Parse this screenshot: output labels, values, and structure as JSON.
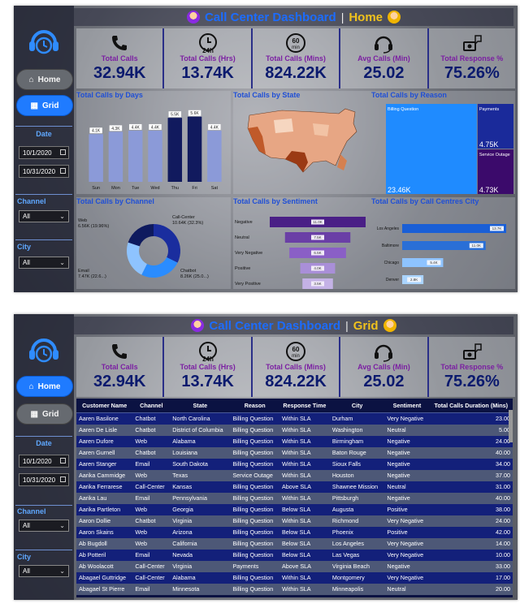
{
  "dashboard_title": "Call Center Dashboard",
  "separator": "|",
  "views": {
    "home": "Home",
    "grid": "Grid"
  },
  "sidebar": {
    "home_label": "Home",
    "grid_label": "Grid",
    "date_label": "Date",
    "start_date": "10/1/2020",
    "end_date": "10/31/2020",
    "channel_label": "Channel",
    "channel_value": "All",
    "city_label": "City",
    "city_value": "All"
  },
  "kpis": [
    {
      "label": "Total Calls",
      "value": "32.94K",
      "icon": "phone-icon"
    },
    {
      "label": "Total Calls (Hrs)",
      "value": "13.74K",
      "icon": "clock-24h-icon"
    },
    {
      "label": "Total Calls (Mins)",
      "value": "824.22K",
      "icon": "clock-60min-icon"
    },
    {
      "label": "Avg Calls (Min)",
      "value": "25.02",
      "icon": "headset-icon"
    },
    {
      "label": "Total Response %",
      "value": "75.26%",
      "icon": "response-icon"
    }
  ],
  "icon_text": {
    "h24": "24h",
    "m60": "60",
    "min": "min"
  },
  "charts": {
    "days": {
      "title": "Total Calls by Days",
      "chart_data": {
        "type": "bar",
        "categories": [
          "Sun",
          "Mon",
          "Tue",
          "Wed",
          "Thu",
          "Fri",
          "Sat"
        ],
        "values": [
          4.1,
          4.3,
          4.4,
          4.4,
          5.5,
          5.6,
          4.4
        ],
        "labels": [
          "4.1K",
          "4.3K",
          "4.4K",
          "4.4K",
          "5.5K",
          "5.6K",
          "4.4K"
        ],
        "colors": [
          "#8b9ad8",
          "#8b9ad8",
          "#8b9ad8",
          "#8b9ad8",
          "#111a5e",
          "#111a5e",
          "#8b9ad8"
        ],
        "ylim": [
          0,
          6
        ]
      }
    },
    "state": {
      "title": "Total Calls by State"
    },
    "reason": {
      "title": "Total Calls by Reason",
      "chart_data": {
        "type": "treemap",
        "categories": [
          "Billing Question",
          "Payments",
          "Service Outage"
        ],
        "values": [
          23.46,
          4.75,
          4.73
        ],
        "labels": [
          "23.46K",
          "4.75K",
          "4.73K"
        ],
        "colors": [
          "#1f8bff",
          "#1a2a9a",
          "#3b0a6b"
        ]
      }
    },
    "channel": {
      "title": "Total Calls by Channel",
      "chart_data": {
        "type": "pie",
        "categories": [
          "Call-Center",
          "Chatbot",
          "Email",
          "Web"
        ],
        "values": [
          10.64,
          8.26,
          7.47,
          6.56
        ],
        "labels": [
          "Call-Center\n10.64K (32.3%)",
          "Chatbot\n8.26K (25.0...)",
          "Email\n7.47K (22.6...)",
          "Web\n6.56K (19.96%)"
        ],
        "colors": [
          "#1a2d9e",
          "#2a8cff",
          "#8ec3ff",
          "#0e1a5e"
        ]
      }
    },
    "sentiment": {
      "title": "Total Calls by Sentiment",
      "chart_data": {
        "type": "bar",
        "orientation": "horizontal",
        "categories": [
          "Negative",
          "Neutral",
          "Very Negative",
          "Positive",
          "Very Positive"
        ],
        "values": [
          11.0,
          7.5,
          6.5,
          4.0,
          3.5
        ],
        "labels": [
          "11.0K",
          "7.5K",
          "6.5K",
          "4.0K",
          "3.5K"
        ],
        "colors": [
          "#4a1f86",
          "#6a3fa6",
          "#8a5fc6",
          "#a98fd8",
          "#c4b2e6"
        ]
      }
    },
    "city": {
      "title": "Total Calls by Call Centres City",
      "chart_data": {
        "type": "bar",
        "orientation": "horizontal",
        "categories": [
          "Los Angeles",
          "Baltimore",
          "Chicago",
          "Denver"
        ],
        "values": [
          13.7,
          11.0,
          5.4,
          2.8
        ],
        "labels": [
          "13.7K",
          "11.0K",
          "5.4K",
          "2.8K"
        ],
        "colors": [
          "#1a5fd6",
          "#2a6fd6",
          "#8ec3ff",
          "#aad4ff"
        ]
      }
    }
  },
  "table": {
    "columns": [
      "Customer Name",
      "Channel",
      "State",
      "Reason",
      "Response Time",
      "City",
      "Sentiment",
      "Total Calls Duration (Mins)"
    ],
    "rows": [
      [
        "Aaren Basilone",
        "Chatbot",
        "North Carolina",
        "Billing Question",
        "Within SLA",
        "Durham",
        "Very Negative",
        "23.00"
      ],
      [
        "Aaren De Lisle",
        "Chatbot",
        "District of Columbia",
        "Billing Question",
        "Within SLA",
        "Washington",
        "Neutral",
        "5.00"
      ],
      [
        "Aaren Dufore",
        "Web",
        "Alabama",
        "Billing Question",
        "Within SLA",
        "Birmingham",
        "Negative",
        "24.00"
      ],
      [
        "Aaren Gurnell",
        "Chatbot",
        "Louisiana",
        "Billing Question",
        "Within SLA",
        "Baton Rouge",
        "Negative",
        "40.00"
      ],
      [
        "Aaren Stanger",
        "Email",
        "South Dakota",
        "Billing Question",
        "Within SLA",
        "Sioux Falls",
        "Negative",
        "34.00"
      ],
      [
        "Aarika Cammidge",
        "Web",
        "Texas",
        "Service Outage",
        "Within SLA",
        "Houston",
        "Negative",
        "37.00"
      ],
      [
        "Aarika Ferrarese",
        "Call-Center",
        "Kansas",
        "Billing Question",
        "Above SLA",
        "Shawnee Mission",
        "Neutral",
        "31.00"
      ],
      [
        "Aarika Lau",
        "Email",
        "Pennsylvania",
        "Billing Question",
        "Within SLA",
        "Pittsburgh",
        "Negative",
        "40.00"
      ],
      [
        "Aarika Partleton",
        "Web",
        "Georgia",
        "Billing Question",
        "Below SLA",
        "Augusta",
        "Positive",
        "38.00"
      ],
      [
        "Aaron Dollie",
        "Chatbot",
        "Virginia",
        "Billing Question",
        "Within SLA",
        "Richmond",
        "Very Negative",
        "24.00"
      ],
      [
        "Aaron Skains",
        "Web",
        "Arizona",
        "Billing Question",
        "Below SLA",
        "Phoenix",
        "Positive",
        "42.00"
      ],
      [
        "Ab Bugdoll",
        "Web",
        "California",
        "Billing Question",
        "Below SLA",
        "Los Angeles",
        "Very Negative",
        "14.00"
      ],
      [
        "Ab Potteril",
        "Email",
        "Nevada",
        "Billing Question",
        "Below SLA",
        "Las Vegas",
        "Very Negative",
        "10.00"
      ],
      [
        "Ab Woolacott",
        "Call-Center",
        "Virginia",
        "Payments",
        "Above SLA",
        "Virginia Beach",
        "Negative",
        "33.00"
      ],
      [
        "Abagael Guttridge",
        "Call-Center",
        "Alabama",
        "Billing Question",
        "Within SLA",
        "Montgomery",
        "Very Negative",
        "17.00"
      ],
      [
        "Abagael St Pierre",
        "Email",
        "Minnesota",
        "Billing Question",
        "Within SLA",
        "Minneapolis",
        "Neutral",
        "20.00"
      ]
    ]
  }
}
